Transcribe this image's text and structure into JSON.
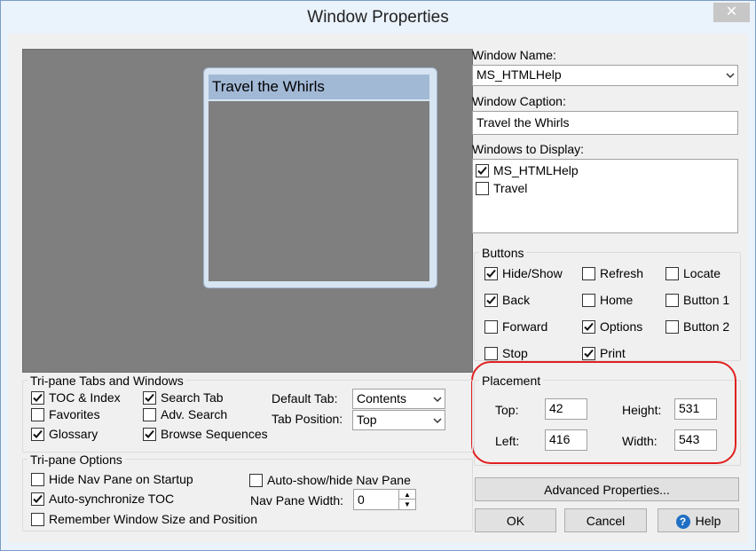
{
  "window": {
    "title": "Window Properties",
    "close_glyph": "✕"
  },
  "preview": {
    "caption": "Travel the Whirls"
  },
  "fields": {
    "window_name_label": "Window Name:",
    "window_name_value": "MS_HTMLHelp",
    "window_caption_label": "Window Caption:",
    "window_caption_value": "Travel the Whirls",
    "windows_to_display_label": "Windows to Display:",
    "windows_to_display": [
      {
        "label": "MS_HTMLHelp",
        "checked": true
      },
      {
        "label": "Travel",
        "checked": false
      }
    ]
  },
  "buttons_group": {
    "title": "Buttons",
    "items": [
      {
        "label": "Hide/Show",
        "checked": true
      },
      {
        "label": "Refresh",
        "checked": false
      },
      {
        "label": "Locate",
        "checked": false
      },
      {
        "label": "Back",
        "checked": true
      },
      {
        "label": "Home",
        "checked": false
      },
      {
        "label": "Button 1",
        "checked": false
      },
      {
        "label": "Forward",
        "checked": false
      },
      {
        "label": "Options",
        "checked": true
      },
      {
        "label": "Button 2",
        "checked": false
      },
      {
        "label": "Stop",
        "checked": false
      },
      {
        "label": "Print",
        "checked": true
      }
    ]
  },
  "placement": {
    "title": "Placement",
    "top_label": "Top:",
    "top_value": "42",
    "left_label": "Left:",
    "left_value": "416",
    "height_label": "Height:",
    "height_value": "531",
    "width_label": "Width:",
    "width_value": "543"
  },
  "tabs_group": {
    "title": "Tri-pane Tabs and Windows",
    "items": [
      {
        "label": "TOC & Index",
        "checked": true
      },
      {
        "label": "Search Tab",
        "checked": true
      },
      {
        "label": "Favorites",
        "checked": false
      },
      {
        "label": "Adv. Search",
        "checked": false
      },
      {
        "label": "Glossary",
        "checked": true
      },
      {
        "label": "Browse Sequences",
        "checked": true
      }
    ],
    "default_tab_label": "Default Tab:",
    "default_tab_value": "Contents",
    "tab_position_label": "Tab Position:",
    "tab_position_value": "Top"
  },
  "options_group": {
    "title": "Tri-pane Options",
    "items": [
      {
        "label": "Hide Nav Pane on Startup",
        "checked": false
      },
      {
        "label": "Auto-show/hide Nav Pane",
        "checked": false
      },
      {
        "label": "Auto-synchronize TOC",
        "checked": true
      },
      {
        "label": "Remember Window Size and Position",
        "checked": false
      }
    ],
    "nav_pane_width_label": "Nav Pane Width:",
    "nav_pane_width_value": "0"
  },
  "actions": {
    "advanced_label": "Advanced Properties...",
    "ok_label": "OK",
    "cancel_label": "Cancel",
    "help_label": "Help",
    "help_icon_glyph": "?"
  },
  "colors": {
    "highlight_ring": "#e0201f",
    "help_icon": "#1f6fc5"
  }
}
